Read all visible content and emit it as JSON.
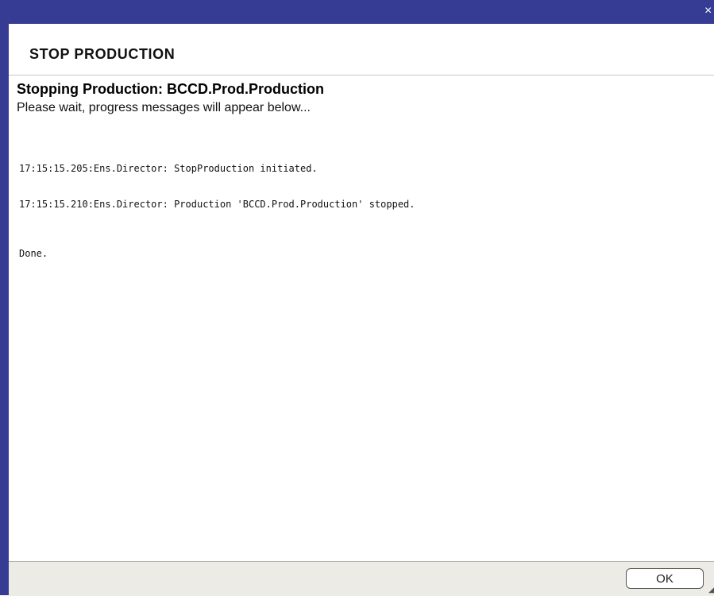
{
  "window": {
    "close_glyph": "×",
    "titlebar_color": "#363b93"
  },
  "dialog": {
    "header_title": "STOP PRODUCTION",
    "stopping_title": "Stopping Production:  BCCD.Prod.Production",
    "subtitle": "Please wait, progress messages will appear below..."
  },
  "log": {
    "lines": [
      "17:15:15.205:Ens.Director: StopProduction initiated.",
      "17:15:15.210:Ens.Director: Production 'BCCD.Prod.Production' stopped."
    ],
    "done": "Done."
  },
  "footer": {
    "ok_label": "OK",
    "resize_glyph": "◢"
  }
}
